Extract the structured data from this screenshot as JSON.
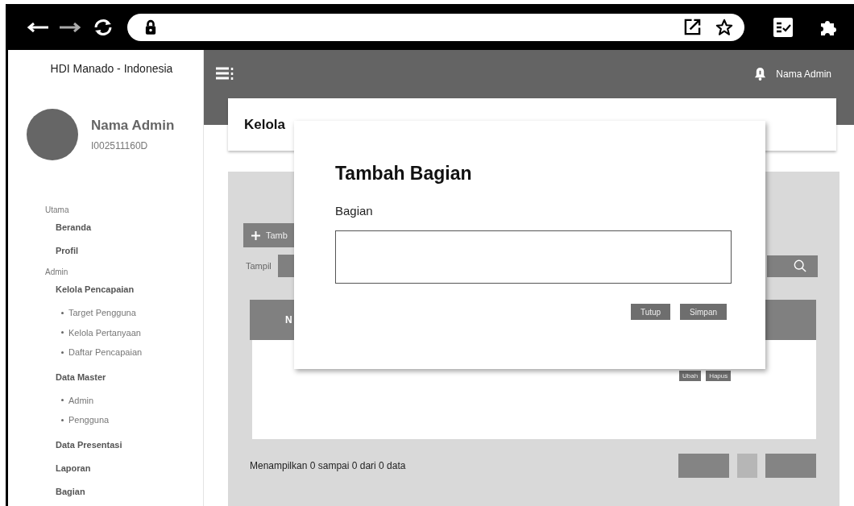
{
  "sidebar": {
    "brand": "HDI Manado - Indonesia",
    "profile": {
      "name": "Nama Admin",
      "id": "I002511160D"
    },
    "sections": [
      {
        "heading": "Utama",
        "items": [
          {
            "label": "Beranda"
          },
          {
            "label": "Profil"
          }
        ]
      },
      {
        "heading": "Admin",
        "items": [
          {
            "label": "Kelola Pencapaian",
            "children": [
              {
                "label": "Target Pengguna"
              },
              {
                "label": "Kelola Pertanyaan"
              },
              {
                "label": "Daftar Pencapaian"
              }
            ]
          },
          {
            "label": "Data Master",
            "children": [
              {
                "label": "Admin"
              },
              {
                "label": "Pengguna"
              }
            ]
          },
          {
            "label": "Data Presentasi"
          },
          {
            "label": "Laporan"
          },
          {
            "label": "Bagian"
          }
        ]
      }
    ]
  },
  "topbar": {
    "user_name": "Nama Admin"
  },
  "page": {
    "title": "Kelola",
    "add_button": "Tamb",
    "show_label": "Tampil",
    "table": {
      "columns": [
        "N"
      ],
      "row_actions": [
        "Ubah",
        "Hapus"
      ]
    },
    "footer": "Menampilkan 0 sampai 0 dari 0 data"
  },
  "modal": {
    "title": "Tambah Bagian",
    "field_label": "Bagian",
    "buttons": [
      "Tutup",
      "Simpan"
    ]
  }
}
